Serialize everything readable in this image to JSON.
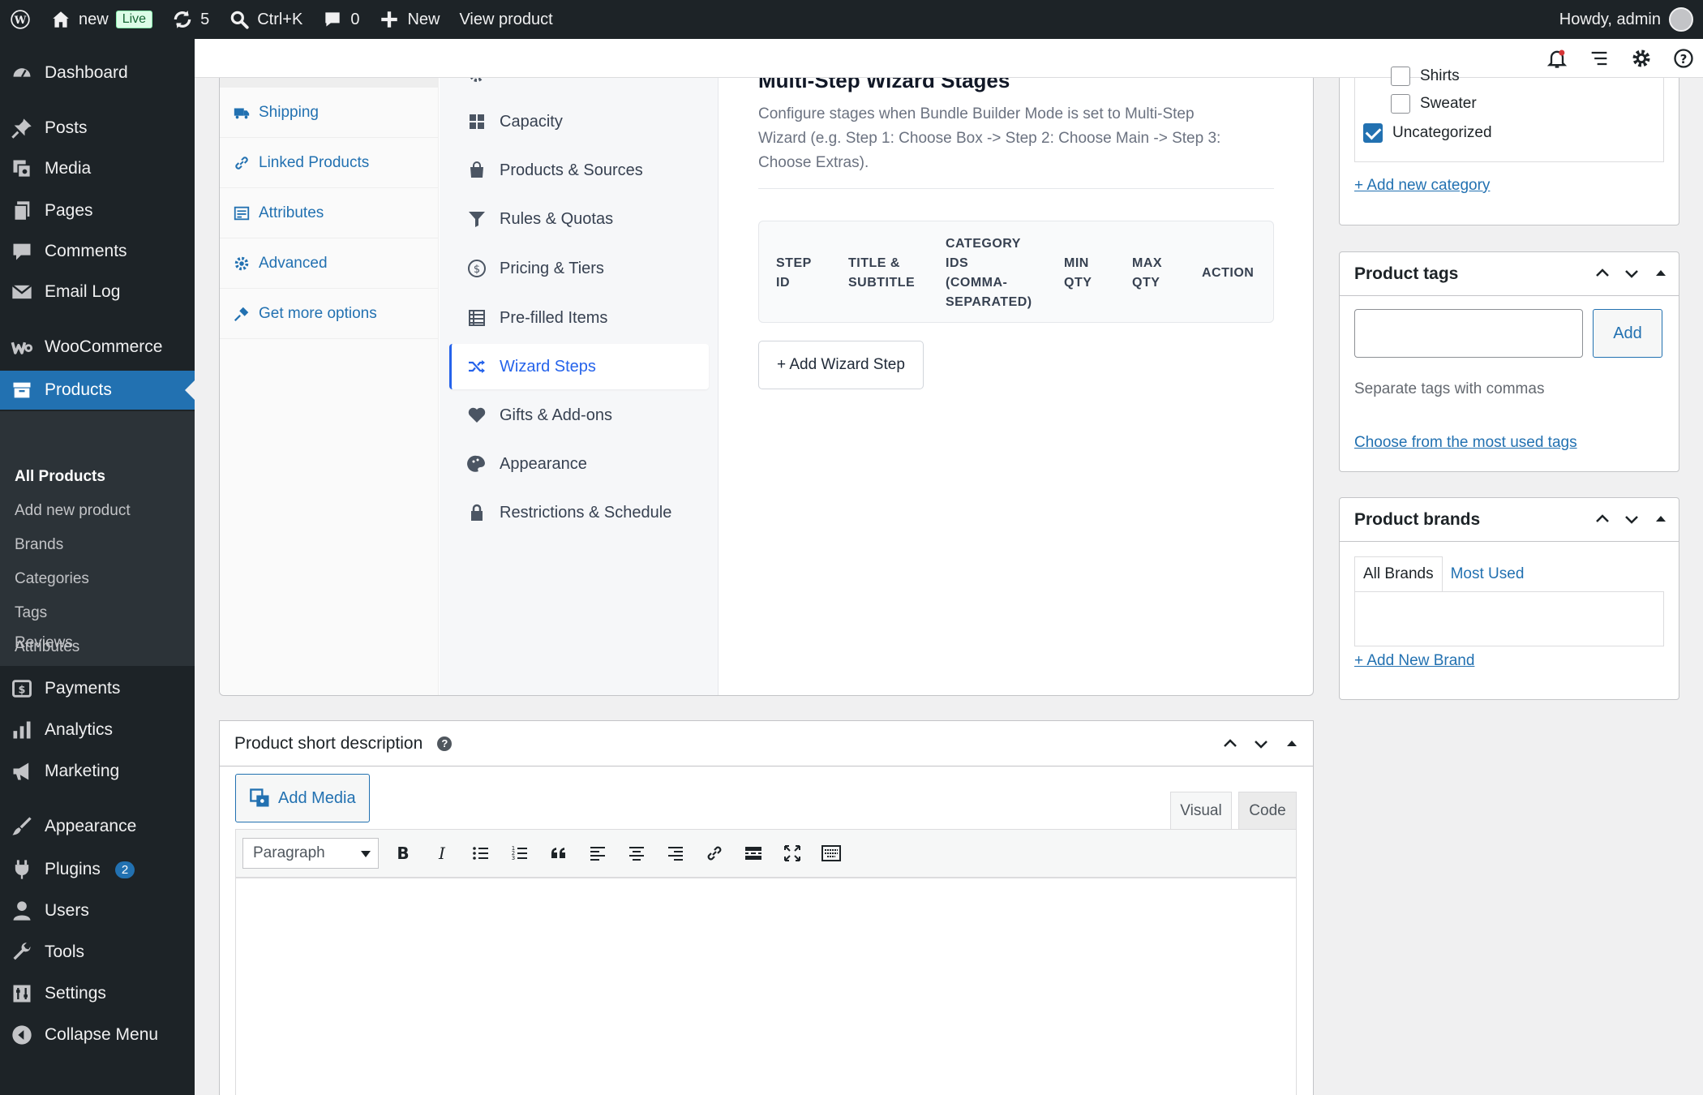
{
  "adminbar": {
    "site_name": "new",
    "live_badge": "Live",
    "updates_count": "5",
    "search_shortcut": "Ctrl+K",
    "comments_count": "0",
    "new_label": "New",
    "view_product": "View product",
    "greeting": "Howdy, admin"
  },
  "sidebar": {
    "dashboard": "Dashboard",
    "posts": "Posts",
    "media": "Media",
    "pages": "Pages",
    "comments": "Comments",
    "email_log": "Email Log",
    "woocommerce": "WooCommerce",
    "products": "Products",
    "submenu": {
      "all_products": "All Products",
      "add_new": "Add new product",
      "brands": "Brands",
      "categories": "Categories",
      "tags": "Tags",
      "attributes": "Attributes",
      "reviews": "Reviews"
    },
    "payments": "Payments",
    "analytics": "Analytics",
    "marketing": "Marketing",
    "appearance": "Appearance",
    "plugins": "Plugins",
    "plugins_badge": "2",
    "users": "Users",
    "tools": "Tools",
    "settings": "Settings",
    "collapse": "Collapse Menu"
  },
  "product_tabs": {
    "shipping": "Shipping",
    "linked": "Linked Products",
    "attributes": "Attributes",
    "advanced": "Advanced",
    "more": "Get more options"
  },
  "bundle_nav": {
    "capacity": "Capacity",
    "products_sources": "Products & Sources",
    "rules": "Rules & Quotas",
    "pricing": "Pricing & Tiers",
    "prefilled": "Pre-filled Items",
    "wizard": "Wizard Steps",
    "gifts": "Gifts & Add-ons",
    "appearance": "Appearance",
    "restrictions": "Restrictions & Schedule"
  },
  "wizard": {
    "heading": "Multi-Step Wizard Stages",
    "description": "Configure stages when Bundle Builder Mode is set to Multi-Step Wizard (e.g. Step 1: Choose Box -> Step 2: Choose Main -> Step 3: Choose Extras).",
    "columns": {
      "step_id_1": "STEP",
      "step_id_2": "ID",
      "title_1": "TITLE &",
      "title_2": "SUBTITLE",
      "cat_1": "CATEGORY",
      "cat_2": "IDS",
      "cat_3": "(COMMA-",
      "cat_4": "SEPARATED)",
      "min_1": "MIN",
      "min_2": "QTY",
      "max_1": "MAX",
      "max_2": "QTY",
      "action": "ACTION"
    },
    "add_step": "+ Add Wizard Step"
  },
  "short_description": {
    "title": "Product short description",
    "help": "?",
    "add_media": "Add Media",
    "tab_visual": "Visual",
    "tab_code": "Code",
    "format": "Paragraph"
  },
  "categories": {
    "shirts": "Shirts",
    "sweater": "Sweater",
    "uncategorized": "Uncategorized",
    "add_new": "+ Add new category"
  },
  "tags": {
    "title": "Product tags",
    "add_button": "Add",
    "hint": "Separate tags with commas",
    "most_used": "Choose from the most used tags"
  },
  "brands": {
    "title": "Product brands",
    "tab_all": "All Brands",
    "tab_most": "Most Used",
    "add_new": "+ Add New Brand"
  }
}
